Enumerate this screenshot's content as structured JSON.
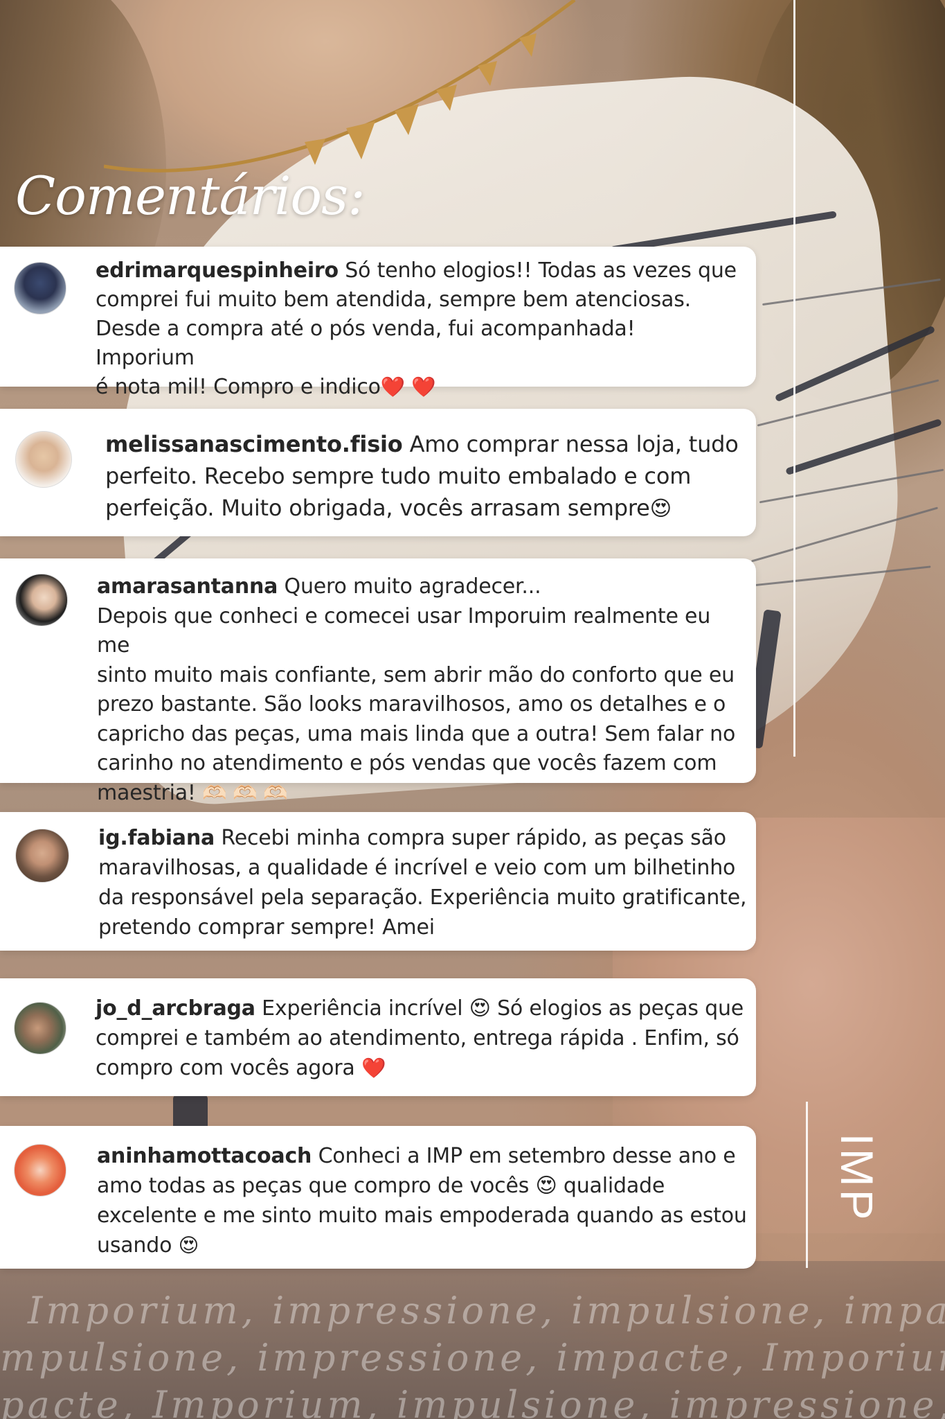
{
  "story": {
    "title": "Comentários:",
    "brand": "IMP"
  },
  "comments": [
    {
      "username": "edrimarquespinheiro",
      "text": "Só tenho elogios!! Todas as vezes que",
      "lines": [
        "comprei fui muito bem atendida, sempre bem atenciosas.",
        "Desde a compra até o pós venda, fui acompanhada! Imporium",
        "é nota mil! Compro e indico"
      ],
      "emoji": "❤️ ❤️"
    },
    {
      "username": "melissanascimento.fisio",
      "text": "Amo comprar nessa loja, tudo",
      "lines": [
        "perfeito. Recebo sempre tudo muito embalado e com",
        "perfeição. Muito obrigada, vocês arrasam sempre"
      ],
      "emoji": "😍"
    },
    {
      "username": "amarasantanna",
      "text": "Quero muito agradecer...",
      "lines": [
        "Depois que conheci e comecei usar Imporuim realmente eu me",
        "sinto muito mais confiante, sem abrir mão do conforto que eu",
        "prezo bastante. São looks maravilhosos, amo os detalhes e o",
        "capricho das peças, uma mais linda que a outra! Sem falar no",
        "carinho no atendimento e pós vendas que vocês fazem com",
        "maestria!"
      ],
      "emoji": "🫶🏻 🫶🏻 🫶🏻"
    },
    {
      "username": "ig.fabiana",
      "text": "Recebi minha compra super rápido, as peças são",
      "lines": [
        "maravilhosas, a qualidade é incrível e veio com um bilhetinho",
        "da responsável pela separação. Experiência muito gratificante,",
        "pretendo comprar sempre! Amei"
      ],
      "emoji": ""
    },
    {
      "username": "jo_d_arcbraga",
      "text": "Experiência incrível 😍 Só elogios as peças que",
      "lines": [
        "comprei e também ao atendimento, entrega rápida . Enfim, só",
        "compro com vocês agora"
      ],
      "emoji": "❤️"
    },
    {
      "username": "aninhamottacoach",
      "text": "Conheci a IMP em setembro desse ano e",
      "lines": [
        "amo todas as peças que compro de vocês 😍 qualidade",
        "excelente e me sinto muito mais empoderada quando as estou",
        "usando"
      ],
      "emoji": "😍"
    }
  ],
  "watermark": {
    "line1": "Imporium, impressione, impulsione, impacte,",
    "line2": "mpulsione, impressione, impacte, Imporium,",
    "line3": "pacte, Imporium, impulsione, impressione, I"
  },
  "colors": {
    "card": "#ffffff",
    "text": "#262626",
    "heart": "#e8365d",
    "overlay_text": "#ffffff"
  }
}
